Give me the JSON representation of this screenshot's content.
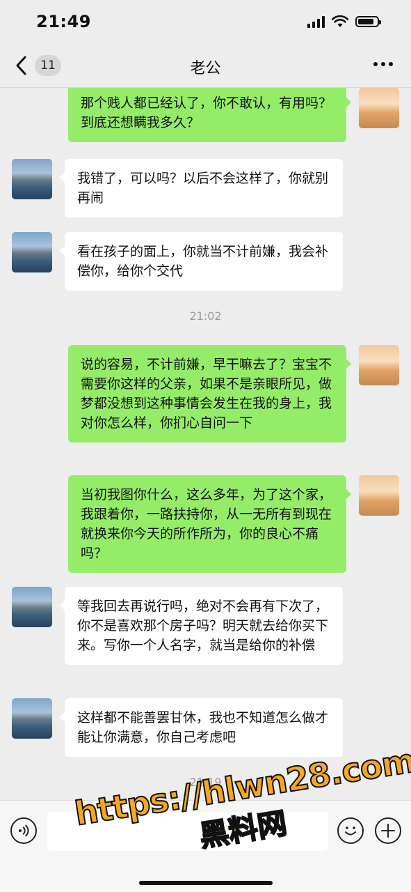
{
  "status_bar": {
    "time": "21:49"
  },
  "nav": {
    "unread_count": "11",
    "title": "老公"
  },
  "messages": [
    {
      "from": "her",
      "text": "那个贱人都已经认了，你不敢认，有用吗？到底还想瞒我多久？"
    },
    {
      "from": "him",
      "text": "我错了，可以吗？以后不会这样了，你就别再闹"
    },
    {
      "from": "him",
      "text": "看在孩子的面上，你就当不计前嫌，我会补偿你，给你个交代"
    },
    {
      "from": "her",
      "text": "说的容易，不计前嫌，早干嘛去了？宝宝不需要你这样的父亲，如果不是亲眼所见，做梦都没想到这种事情会发生在我的身上，我对你怎么样，你扪心自问一下"
    },
    {
      "from": "her",
      "text": "当初我图你什么，这么多年，为了这个家，我跟着你，一路扶持你，从一无所有到现在就换来你今天的所作所为，你的良心不痛吗？"
    },
    {
      "from": "him",
      "text": "等我回去再说行吗，绝对不会再有下次了，你不是喜欢那个房子吗？明天就去给你买下来。写你一个人名字，就当是给你的补偿"
    },
    {
      "from": "him",
      "text": "这样都不能善罢甘休，我也不知道怎么做才能让你满意，你自己考虑吧"
    }
  ],
  "timestamps": [
    "21:02",
    "21:19"
  ],
  "input_bar": {
    "voice_icon": "voice-icon",
    "emoji_icon": "emoji-icon",
    "add_icon": "plus-icon"
  },
  "watermark": {
    "url": "https://hlwn28.com",
    "brand": "黑料网"
  },
  "colors": {
    "outgoing_bubble": "#95ec69",
    "incoming_bubble": "#ffffff",
    "background": "#ededed",
    "watermark": "#f5a623"
  }
}
